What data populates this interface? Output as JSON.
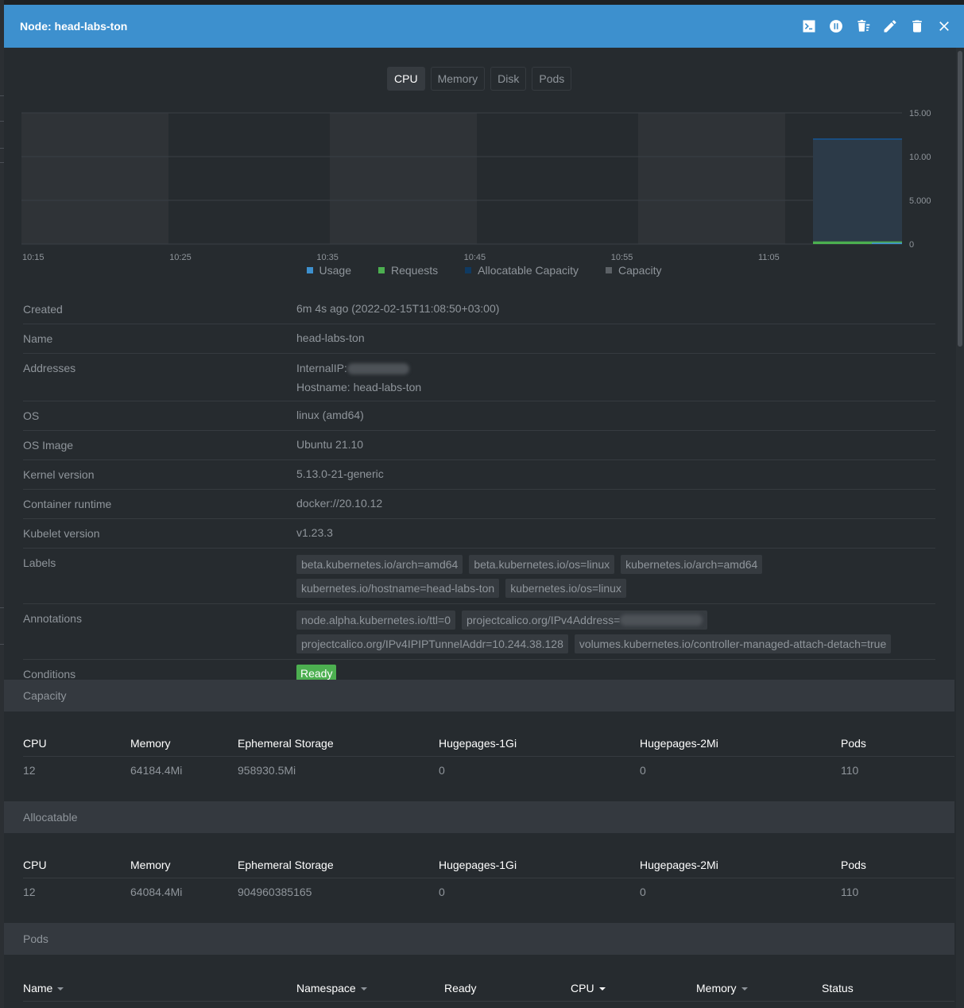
{
  "header": {
    "title": "Node: head-labs-ton"
  },
  "tabs": [
    {
      "label": "CPU",
      "active": true
    },
    {
      "label": "Memory",
      "active": false
    },
    {
      "label": "Disk",
      "active": false
    },
    {
      "label": "Pods",
      "active": false
    }
  ],
  "chart_data": {
    "type": "bar",
    "x_ticks": [
      "10:15",
      "10:25",
      "10:35",
      "10:45",
      "10:55",
      "11:05"
    ],
    "y_ticks": [
      "15.00",
      "10.00",
      "5.000",
      "0"
    ],
    "ylim": [
      0,
      15
    ],
    "series": [
      {
        "name": "Usage",
        "color": "#3d90ce",
        "values": [
          0.15
        ]
      },
      {
        "name": "Requests",
        "color": "#4caf50",
        "values": [
          0.3
        ]
      },
      {
        "name": "Allocatable Capacity",
        "color": "#0f3a62",
        "values": [
          12
        ]
      },
      {
        "name": "Capacity",
        "color": "#5c6166",
        "values": [
          12
        ]
      }
    ],
    "legend_position": "bottom"
  },
  "details": {
    "created": {
      "label": "Created",
      "value": "6m 4s ago (2022-02-15T11:08:50+03:00)"
    },
    "name": {
      "label": "Name",
      "value": "head-labs-ton"
    },
    "addresses": {
      "label": "Addresses",
      "internal_prefix": "InternalIP:",
      "hostname": "Hostname: head-labs-ton"
    },
    "os": {
      "label": "OS",
      "value": "linux (amd64)"
    },
    "os_image": {
      "label": "OS Image",
      "value": "Ubuntu 21.10"
    },
    "kernel": {
      "label": "Kernel version",
      "value": "5.13.0-21-generic"
    },
    "runtime": {
      "label": "Container runtime",
      "value": "docker://20.10.12"
    },
    "kubelet": {
      "label": "Kubelet version",
      "value": "v1.23.3"
    },
    "labels": {
      "label": "Labels",
      "items": [
        "beta.kubernetes.io/arch=amd64",
        "beta.kubernetes.io/os=linux",
        "kubernetes.io/arch=amd64",
        "kubernetes.io/hostname=head-labs-ton",
        "kubernetes.io/os=linux"
      ]
    },
    "annotations": {
      "label": "Annotations",
      "items": [
        "node.alpha.kubernetes.io/ttl=0",
        "projectcalico.org/IPv4Address=",
        "projectcalico.org/IPv4IPIPTunnelAddr=10.244.38.128",
        "volumes.kubernetes.io/controller-managed-attach-detach=true"
      ]
    },
    "conditions": {
      "label": "Conditions",
      "status": "Ready"
    }
  },
  "capacity": {
    "title": "Capacity",
    "headers": [
      "CPU",
      "Memory",
      "Ephemeral Storage",
      "Hugepages-1Gi",
      "Hugepages-2Mi",
      "Pods"
    ],
    "values": [
      "12",
      "64184.4Mi",
      "958930.5Mi",
      "0",
      "0",
      "110"
    ]
  },
  "allocatable": {
    "title": "Allocatable",
    "headers": [
      "CPU",
      "Memory",
      "Ephemeral Storage",
      "Hugepages-1Gi",
      "Hugepages-2Mi",
      "Pods"
    ],
    "values": [
      "12",
      "64084.4Mi",
      "904960385165",
      "0",
      "0",
      "110"
    ]
  },
  "pods": {
    "title": "Pods",
    "headers": [
      "Name",
      "Namespace",
      "Ready",
      "CPU",
      "Memory",
      "Status"
    ]
  }
}
